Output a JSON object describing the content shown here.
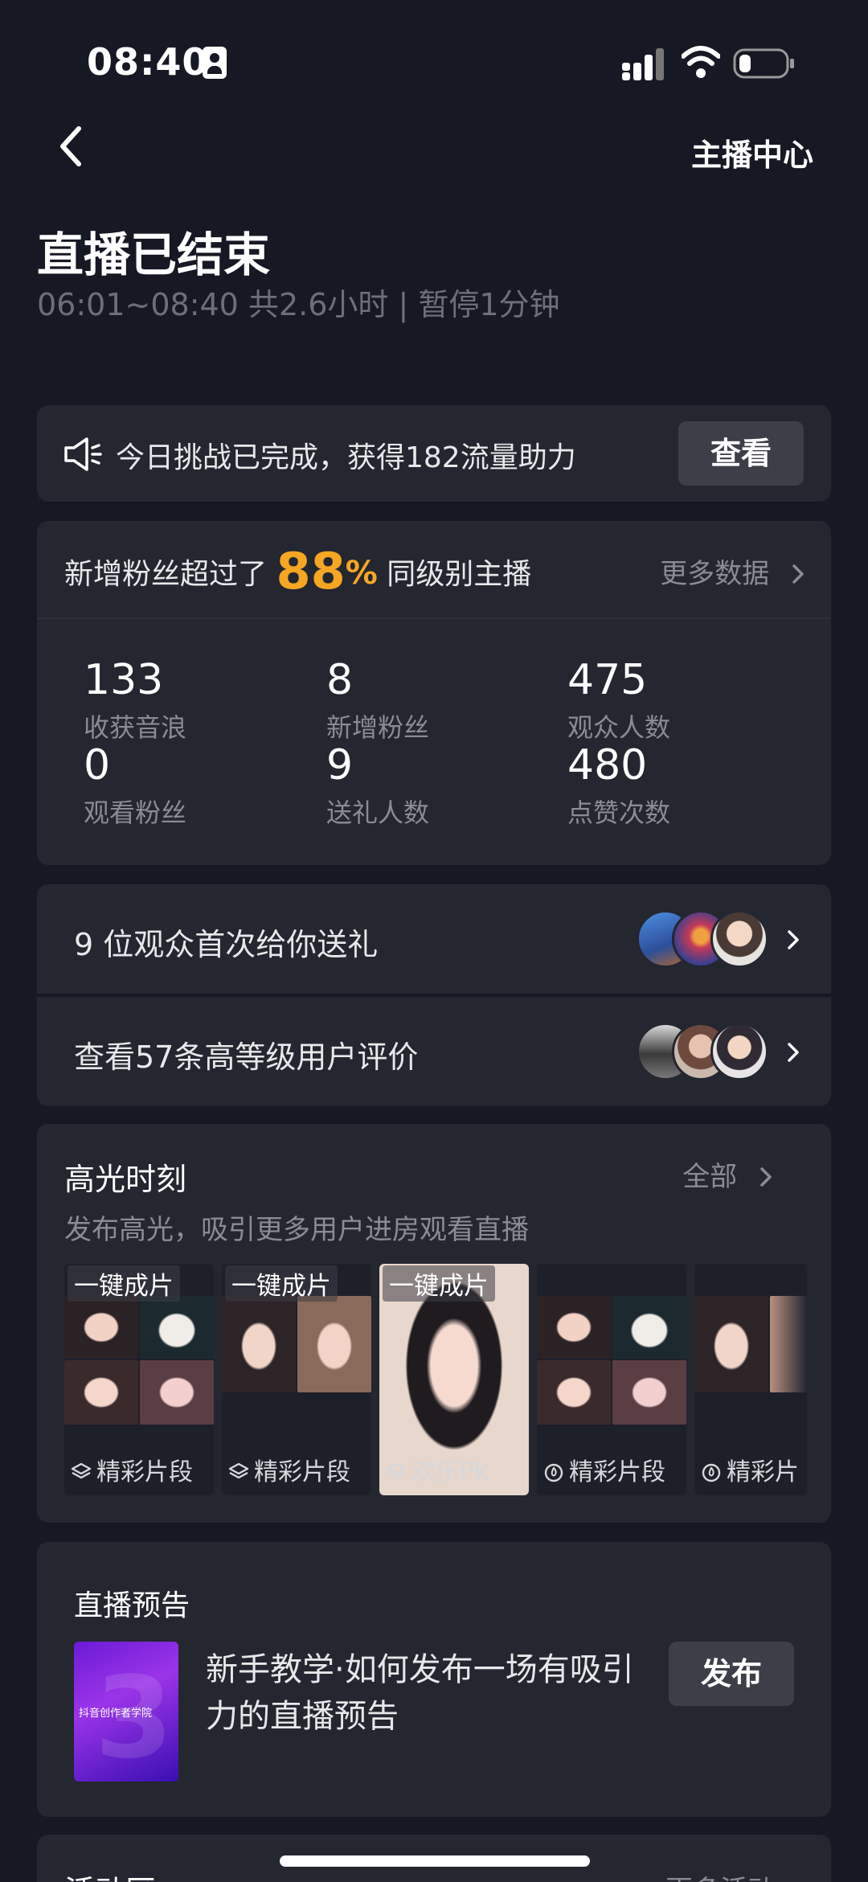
{
  "status_bar": {
    "time": "08:40"
  },
  "header": {
    "right_link": "主播中心"
  },
  "summary": {
    "title": "直播已结束",
    "subtitle": "06:01~08:40 共2.6小时 | 暂停1分钟"
  },
  "challenge": {
    "text": "今日挑战已完成，获得182流量助力",
    "button": "查看"
  },
  "stats": {
    "head_prefix": "新增粉丝超过了",
    "head_percent": "88",
    "head_percent_sign": "%",
    "head_suffix": "同级别主播",
    "more_label": "更多数据",
    "items": [
      {
        "value": "133",
        "label": "收获音浪"
      },
      {
        "value": "8",
        "label": "新增粉丝"
      },
      {
        "value": "475",
        "label": "观众人数"
      },
      {
        "value": "0",
        "label": "观看粉丝"
      },
      {
        "value": "9",
        "label": "送礼人数"
      },
      {
        "value": "480",
        "label": "点赞次数"
      }
    ]
  },
  "rows": [
    {
      "text": "9 位观众首次给你送礼"
    },
    {
      "text": "查看57条高等级用户评价"
    }
  ],
  "highlights": {
    "title": "高光时刻",
    "all_label": "全部",
    "subtitle": "发布高光，吸引更多用户进房观看直播",
    "clips": [
      {
        "badge": "一键成片",
        "caption": "精彩片段",
        "icon": "layers-icon"
      },
      {
        "badge": "一键成片",
        "caption": "精彩片段",
        "icon": "layers-icon"
      },
      {
        "badge": "一键成片",
        "caption": "欢乐PK",
        "icon": "layers-icon"
      },
      {
        "badge": "",
        "caption": "精彩片段",
        "icon": "flame-icon"
      },
      {
        "badge": "",
        "caption": "精彩片",
        "icon": "flame-icon"
      }
    ]
  },
  "preview": {
    "title": "直播预告",
    "thumb_label": "抖音创作者学院",
    "text": "新手教学·如何发布一场有吸引力的直播预告",
    "button": "发布"
  },
  "activity": {
    "title": "活动区",
    "more_label": "更多活动"
  },
  "colors": {
    "background": "#161823",
    "card": "#242630",
    "accent": "#f5a623",
    "muted": "#8a8c94"
  }
}
